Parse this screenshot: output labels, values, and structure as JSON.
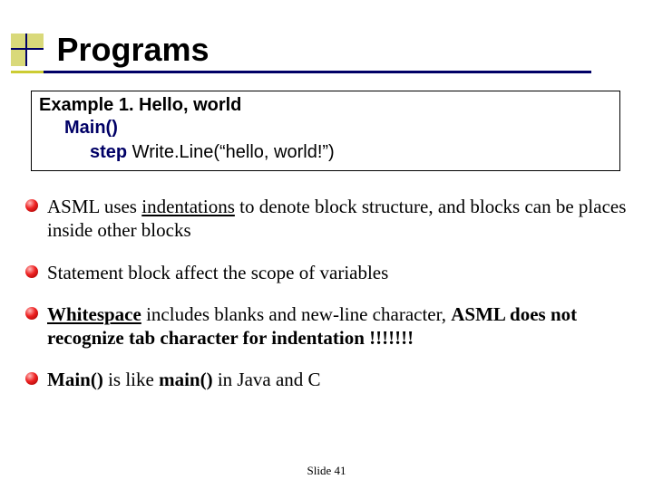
{
  "title": "Programs",
  "example": {
    "heading": "Example 1. Hello, world",
    "lines": [
      {
        "indent": 1,
        "keyword": "Main()",
        "rest": ""
      },
      {
        "indent": 2,
        "keyword": "step",
        "rest": " Write.Line(“hello, world!”)"
      }
    ]
  },
  "bullets": [
    {
      "segments": [
        {
          "t": "ASML uses "
        },
        {
          "t": "indentations",
          "u": true
        },
        {
          "t": " to denote block structure, and blocks can be places inside other blocks"
        }
      ]
    },
    {
      "segments": [
        {
          "t": "Statement block affect the scope of variables"
        }
      ]
    },
    {
      "segments": [
        {
          "t": "Whitespace",
          "b": true,
          "u": true
        },
        {
          "t": " includes blanks and new-line character, "
        },
        {
          "t": "ASML does not recognize tab character for indentation !!!!!!!",
          "b": true
        }
      ]
    },
    {
      "segments": [
        {
          "t": "Main()",
          "b": true
        },
        {
          "t": " is like "
        },
        {
          "t": "main()",
          "b": true
        },
        {
          "t": " in Java and C"
        }
      ]
    }
  ],
  "footer": "Slide  41"
}
